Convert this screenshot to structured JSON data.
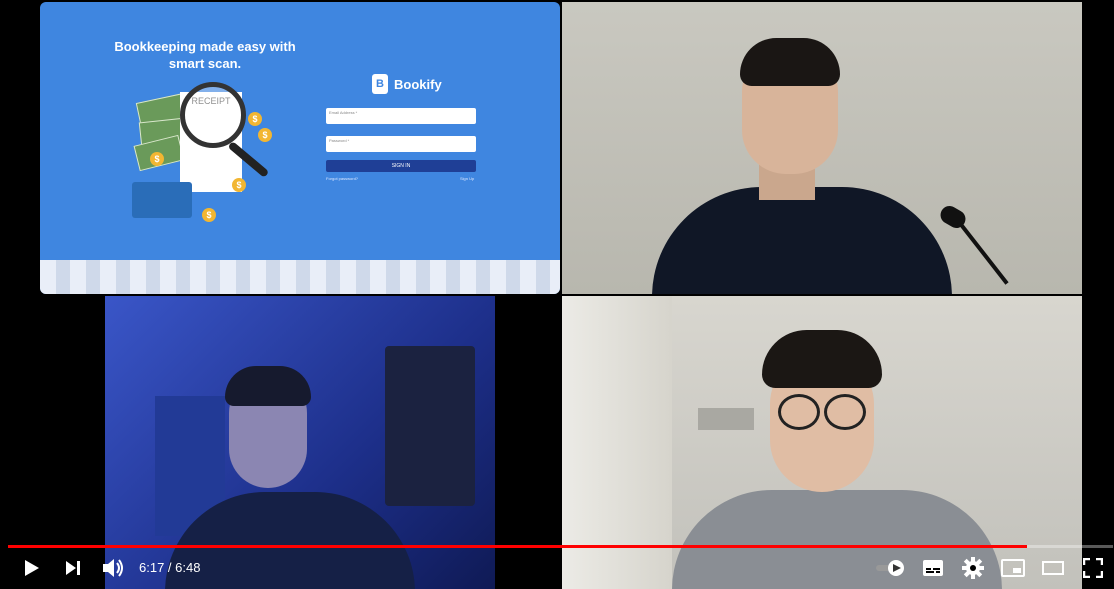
{
  "shared_screen": {
    "headline": "Bookkeeping made easy with smart scan.",
    "receipt_label": "RECEIPT",
    "coin_symbol": "$",
    "logo_initial": "B",
    "app_name": "Bookify",
    "email_placeholder": "Email Address *",
    "password_placeholder": "Password *",
    "signin_label": "SIGN IN",
    "forgot_label": "Forgot password?",
    "signup_label": "Sign Up"
  },
  "player": {
    "current_time": "6:17",
    "separator": " / ",
    "duration": "6:48",
    "progress_fraction": 0.922
  },
  "icons": {
    "play": "play-icon",
    "next": "next-icon",
    "volume": "volume-icon",
    "autoplay": "autoplay-toggle-icon",
    "subtitles": "subtitles-icon",
    "settings": "gear-icon",
    "miniplayer": "miniplayer-icon",
    "theater": "theater-icon",
    "fullscreen": "fullscreen-icon"
  }
}
